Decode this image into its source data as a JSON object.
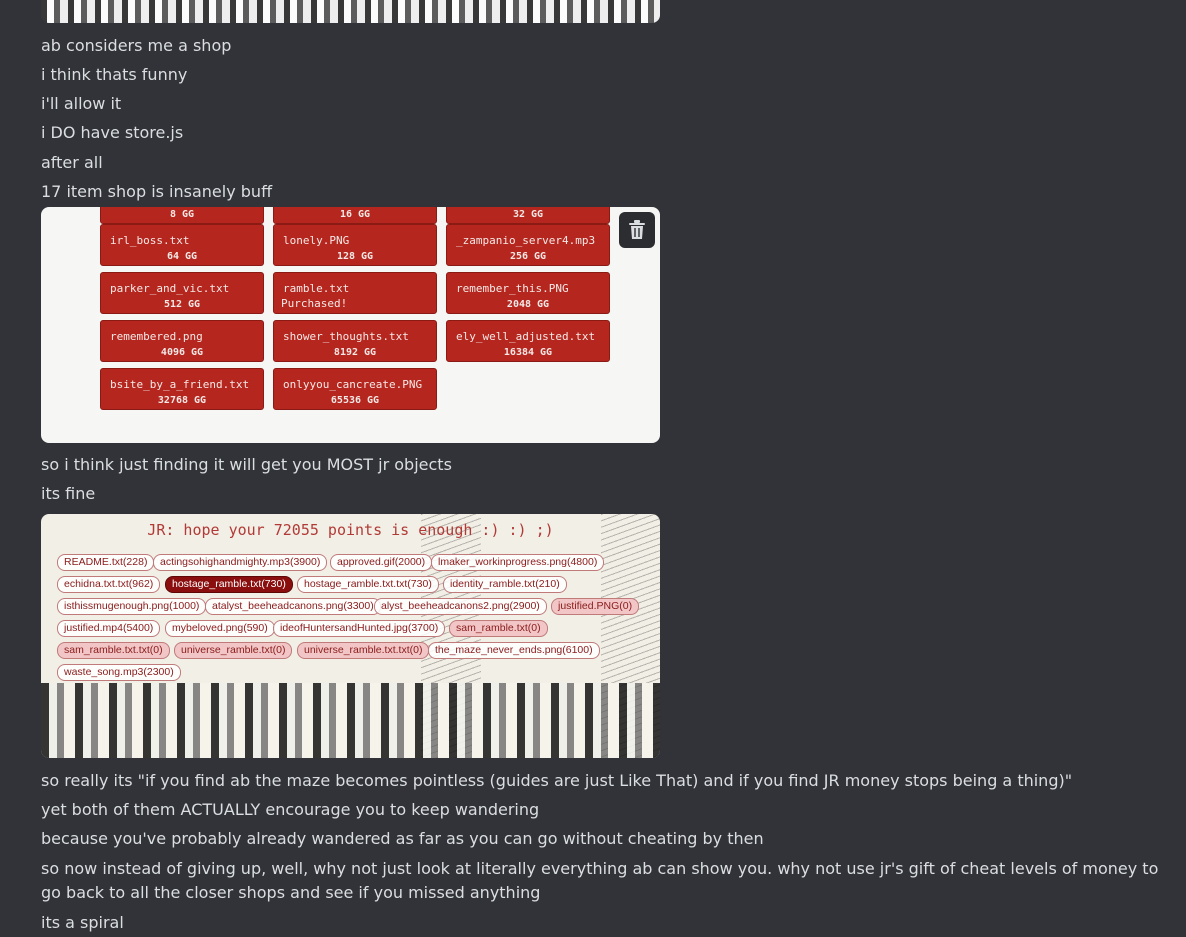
{
  "messages": [
    "ab considers me a shop",
    "i think thats funny",
    "i'll allow it",
    "i DO have store.js",
    "after all",
    "17 item shop is insanely buff",
    "so i think just finding it will get you MOST jr objects",
    "its fine",
    "so really its \"if you find ab the maze becomes pointless (guides are just Like That) and if you find JR money stops being a thing)\"",
    "yet both of them ACTUALLY encourage you to keep wandering",
    "because you've probably already wandered as far as you can go without cheating by then",
    "so now instead of giving up, well, why not just look at literally everything ab can show you. why not use jr's gift of cheat levels of money to go back to all the closer shops and see if you missed anything",
    "its a spiral"
  ],
  "shop": {
    "items": [
      {
        "name": "",
        "price": "8 GG"
      },
      {
        "name": "",
        "price": "16 GG"
      },
      {
        "name": "",
        "price": "32 GG"
      },
      {
        "name": "irl_boss.txt",
        "price": "64 GG"
      },
      {
        "name": "lonely.PNG",
        "price": "128 GG"
      },
      {
        "name": "_zampanio_server4.mp3",
        "price": "256 GG"
      },
      {
        "name": "parker_and_vic.txt",
        "price": "512 GG"
      },
      {
        "name": "ramble.txt",
        "price": "Purchased!"
      },
      {
        "name": "remember_this.PNG",
        "price": "2048 GG"
      },
      {
        "name": "remembered.png",
        "price": "4096 GG"
      },
      {
        "name": "shower_thoughts.txt",
        "price": "8192 GG"
      },
      {
        "name": "ely_well_adjusted.txt",
        "price": "16384 GG"
      },
      {
        "name": "bsite_by_a_friend.txt",
        "price": "32768 GG"
      },
      {
        "name": "onlyyou_cancreate.PNG",
        "price": "65536 GG"
      }
    ],
    "trash_icon": "trash-icon"
  },
  "jr": {
    "header": "JR: hope your 72055 points is enough :) :) ;)",
    "pills": [
      "README.txt(228)",
      "actingsohighandmighty.mp3(3900)",
      "approved.gif(2000)",
      "lmaker_workinprogress.png(4800)",
      "echidna.txt.txt(962)",
      "hostage_ramble.txt(730)",
      "hostage_ramble.txt.txt(730)",
      "identity_ramble.txt(210)",
      "isthissmugenough.png(1000)",
      "atalyst_beeheadcanons.png(3300)",
      "alyst_beeheadcanons2.png(2900)",
      "justified.PNG(0)",
      "justified.mp4(5400)",
      "mybeloved.png(590)",
      "ideofHuntersandHunted.jpg(3700)",
      "sam_ramble.txt(0)",
      "sam_ramble.txt.txt(0)",
      "universe_ramble.txt(0)",
      "universe_ramble.txt.txt(0)",
      "the_maze_never_ends.png(6100)",
      "waste_song.mp3(2300)"
    ]
  }
}
